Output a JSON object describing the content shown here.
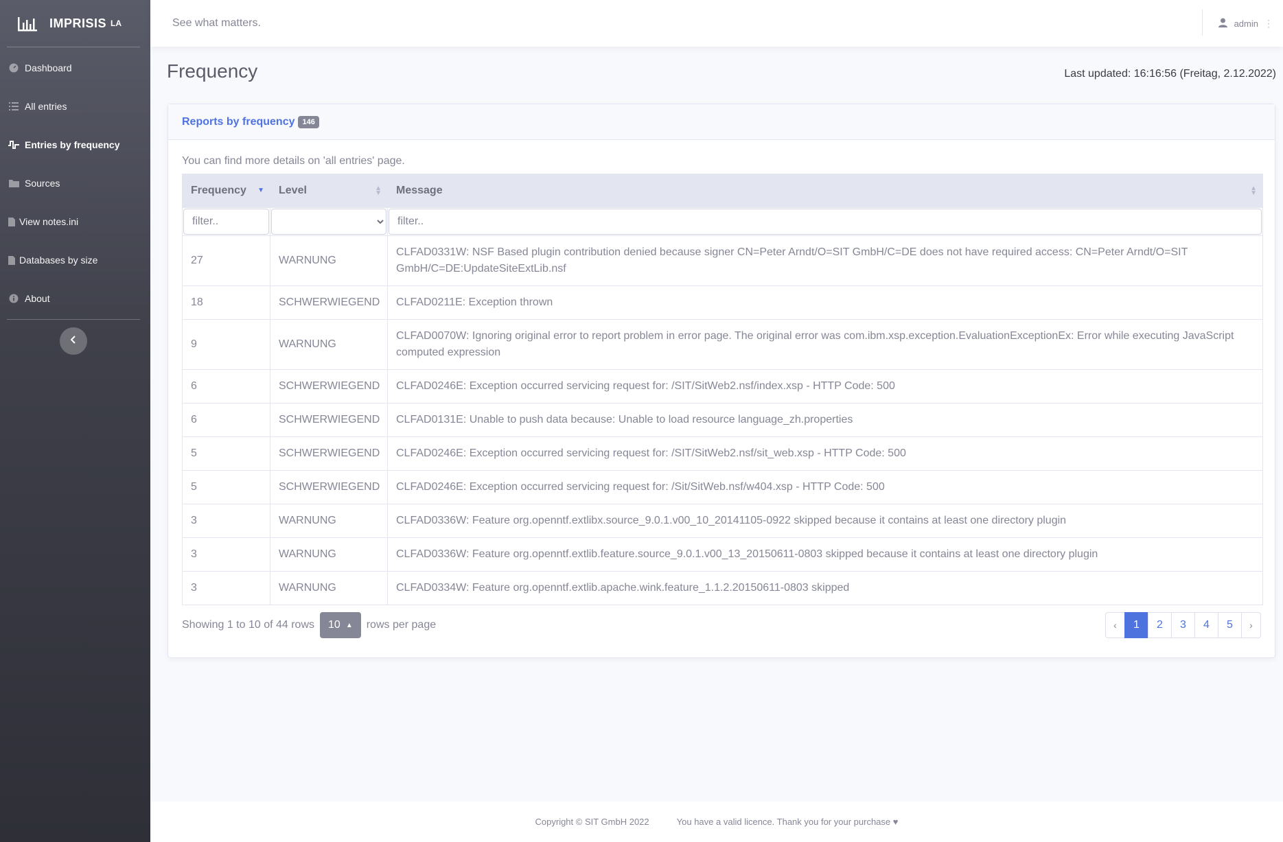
{
  "sidebar": {
    "brand": "IMPRISIS",
    "brand_sup": "LA",
    "items": [
      {
        "label": "Dashboard",
        "icon": "dashboard-icon"
      },
      {
        "label": "All entries",
        "icon": "list-icon"
      },
      {
        "label": "Entries by frequency",
        "icon": "frequency-icon",
        "active": true
      },
      {
        "label": "Sources",
        "icon": "folder-icon"
      },
      {
        "label": "View notes.ini",
        "icon": "file-icon"
      },
      {
        "label": "Databases by size",
        "icon": "file-icon"
      },
      {
        "label": "About",
        "icon": "info-icon"
      }
    ]
  },
  "topbar": {
    "tagline": "See what matters.",
    "user": "admin"
  },
  "page": {
    "title": "Frequency",
    "last_updated": "Last updated: 16:16:56 (Freitag, 2.12.2022)"
  },
  "card": {
    "title": "Reports by frequency",
    "badge": "146",
    "info": "You can find more details on 'all entries' page."
  },
  "table": {
    "columns": [
      "Frequency",
      "Level",
      "Message"
    ],
    "filter_placeholder": "filter..",
    "rows": [
      {
        "frequency": "27",
        "level": "WARNUNG",
        "message": "CLFAD0331W: NSF Based plugin contribution denied because signer CN=Peter Arndt/O=SIT GmbH/C=DE does not have required access: CN=Peter Arndt/O=SIT GmbH/C=DE:UpdateSiteExtLib.nsf"
      },
      {
        "frequency": "18",
        "level": "SCHWERWIEGEND",
        "message": "CLFAD0211E: Exception thrown"
      },
      {
        "frequency": "9",
        "level": "WARNUNG",
        "message": "CLFAD0070W: Ignoring original error to report problem in error page. The original error was com.ibm.xsp.exception.EvaluationExceptionEx: Error while executing JavaScript computed expression"
      },
      {
        "frequency": "6",
        "level": "SCHWERWIEGEND",
        "message": "CLFAD0246E: Exception occurred servicing request for: /SIT/SitWeb2.nsf/index.xsp - HTTP Code: 500"
      },
      {
        "frequency": "6",
        "level": "SCHWERWIEGEND",
        "message": "CLFAD0131E: Unable to push data because: Unable to load resource language_zh.properties"
      },
      {
        "frequency": "5",
        "level": "SCHWERWIEGEND",
        "message": "CLFAD0246E: Exception occurred servicing request for: /SIT/SitWeb2.nsf/sit_web.xsp - HTTP Code: 500"
      },
      {
        "frequency": "5",
        "level": "SCHWERWIEGEND",
        "message": "CLFAD0246E: Exception occurred servicing request for: /Sit/SitWeb.nsf/w404.xsp - HTTP Code: 500"
      },
      {
        "frequency": "3",
        "level": "WARNUNG",
        "message": "CLFAD0336W: Feature org.openntf.extlibx.source_9.0.1.v00_10_20141105-0922 skipped because it contains at least one directory plugin"
      },
      {
        "frequency": "3",
        "level": "WARNUNG",
        "message": "CLFAD0336W: Feature org.openntf.extlib.feature.source_9.0.1.v00_13_20150611-0803 skipped because it contains at least one directory plugin"
      },
      {
        "frequency": "3",
        "level": "WARNUNG",
        "message": "CLFAD0334W: Feature org.openntf.extlib.apache.wink.feature_1.1.2.20150611-0803 skipped"
      }
    ],
    "showing": "Showing 1 to 10 of 44 rows",
    "page_size": "10",
    "rows_per_page": "rows per page",
    "pages": [
      "1",
      "2",
      "3",
      "4",
      "5"
    ],
    "prev": "‹",
    "next": "›",
    "current_page": "1"
  },
  "footer": {
    "copyright": "Copyright © SIT GmbH 2022",
    "licence": "You have a valid licence. Thank you for your purchase ♥"
  },
  "colors": {
    "accent": "#4e73df",
    "sidebar_top": "#5a5c69",
    "sidebar_bottom": "#2e2f37",
    "muted": "#858796"
  }
}
